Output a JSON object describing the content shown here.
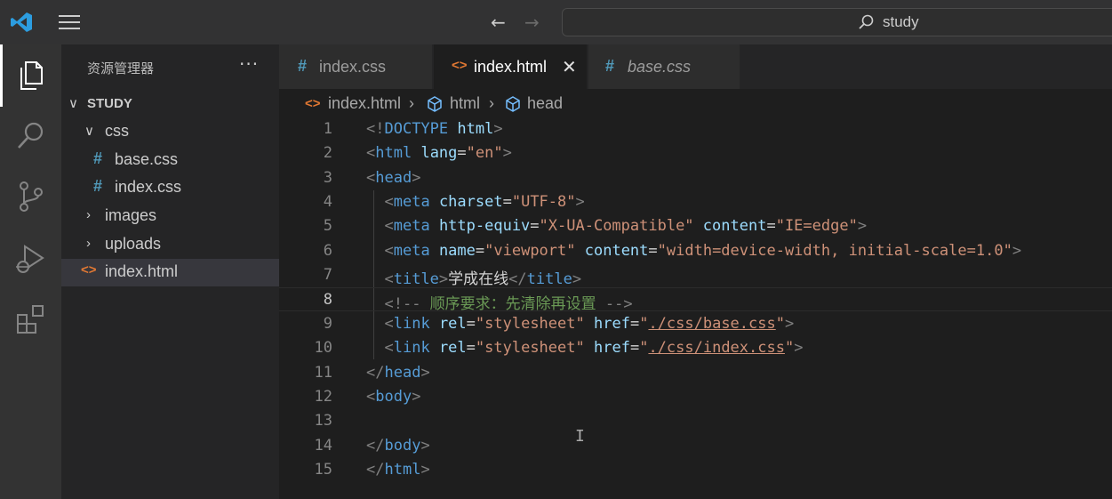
{
  "titlebar": {
    "search_text": "study"
  },
  "activitybar": {
    "items": [
      "explorer-icon",
      "search-icon",
      "source-control-icon",
      "run-debug-icon",
      "extensions-icon"
    ]
  },
  "sidebar": {
    "title": "资源管理器",
    "more": "···",
    "root": "STUDY",
    "items": [
      {
        "label": "css",
        "type": "folder",
        "open": true
      },
      {
        "label": "base.css",
        "type": "css"
      },
      {
        "label": "index.css",
        "type": "css"
      },
      {
        "label": "images",
        "type": "folder",
        "open": false
      },
      {
        "label": "uploads",
        "type": "folder",
        "open": false
      },
      {
        "label": "index.html",
        "type": "html",
        "selected": true
      }
    ]
  },
  "tabs": [
    {
      "label": "index.css",
      "type": "css",
      "active": false
    },
    {
      "label": "index.html",
      "type": "html",
      "active": true
    },
    {
      "label": "base.css",
      "type": "css",
      "active": false
    }
  ],
  "breadcrumb": [
    "index.html",
    "html",
    "head"
  ],
  "code": {
    "current_line": 8,
    "lines": [
      {
        "n": "1",
        "text": "<!DOCTYPE html>"
      },
      {
        "n": "2",
        "text": "<html lang=\"en\">"
      },
      {
        "n": "3",
        "text": "<head>"
      },
      {
        "n": "4",
        "text": "  <meta charset=\"UTF-8\">"
      },
      {
        "n": "5",
        "text": "  <meta http-equiv=\"X-UA-Compatible\" content=\"IE=edge\">"
      },
      {
        "n": "6",
        "text": "  <meta name=\"viewport\" content=\"width=device-width, initial-scale=1.0\">"
      },
      {
        "n": "7",
        "text": "  <title>学成在线</title>"
      },
      {
        "n": "8",
        "text": "  <!-- 顺序要求：先清除再设置 -->"
      },
      {
        "n": "9",
        "text": "  <link rel=\"stylesheet\" href=\"./css/base.css\">"
      },
      {
        "n": "10",
        "text": "  <link rel=\"stylesheet\" href=\"./css/index.css\">"
      },
      {
        "n": "11",
        "text": "</head>"
      },
      {
        "n": "12",
        "text": "<body>"
      },
      {
        "n": "13",
        "text": ""
      },
      {
        "n": "14",
        "text": "</body>"
      },
      {
        "n": "15",
        "text": "</html>"
      }
    ]
  }
}
